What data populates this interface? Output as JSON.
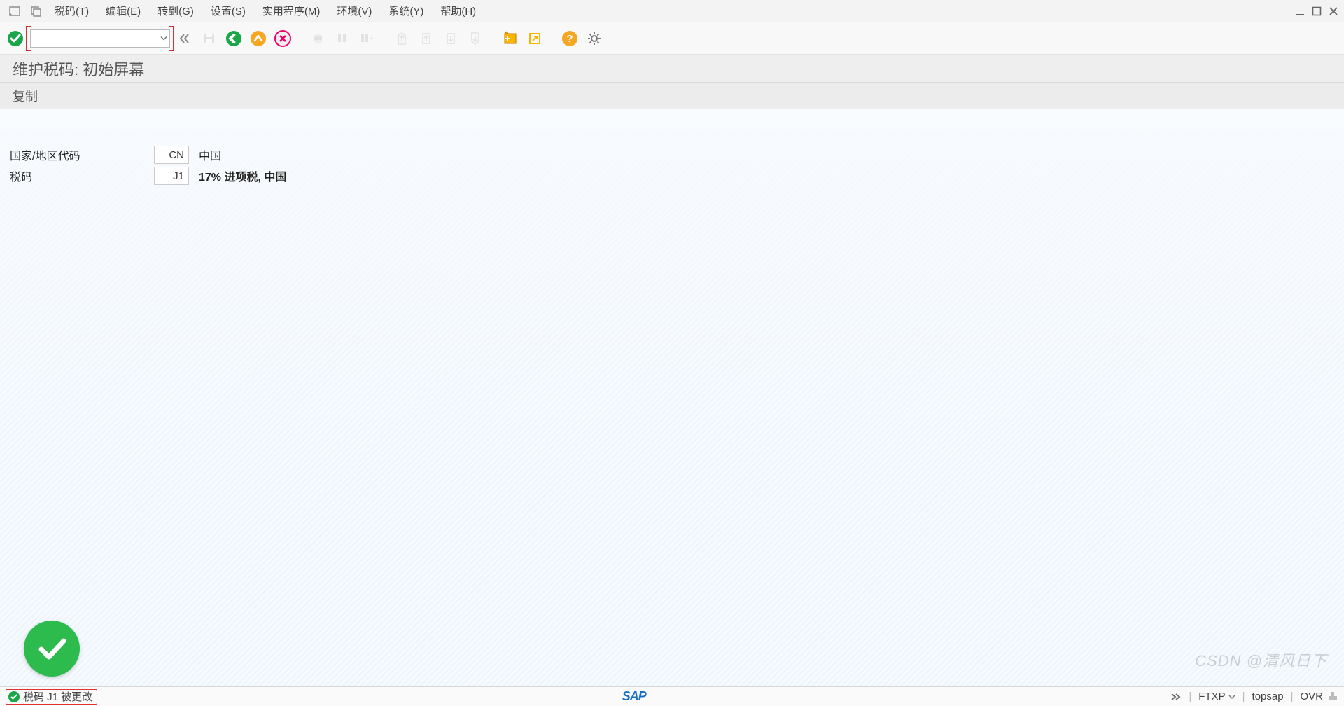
{
  "menu": {
    "items": [
      {
        "label": "税码(T)",
        "u": "T"
      },
      {
        "label": "编辑(E)",
        "u": "E"
      },
      {
        "label": "转到(G)",
        "u": "G"
      },
      {
        "label": "设置(S)",
        "u": "S"
      },
      {
        "label": "实用程序(M)",
        "u": "M"
      },
      {
        "label": "环境(V)",
        "u": "V"
      },
      {
        "label": "系统(Y)",
        "u": "Y"
      },
      {
        "label": "帮助(H)",
        "u": "H"
      }
    ]
  },
  "toolbar": {
    "command_value": ""
  },
  "titlebar": {
    "text": "维护税码: 初始屏幕"
  },
  "appbar": {
    "copy_label": "复制"
  },
  "form": {
    "country": {
      "label": "国家/地区代码",
      "value": "CN",
      "desc": "中国"
    },
    "taxcode": {
      "label": "税码",
      "value": "J1",
      "desc": "17% 进项税, 中国"
    }
  },
  "status": {
    "message": "税码 J1 被更改",
    "tcode": "FTXP",
    "user": "topsap",
    "mode": "OVR"
  },
  "brand": "SAP",
  "watermark": "CSDN @清风日下"
}
